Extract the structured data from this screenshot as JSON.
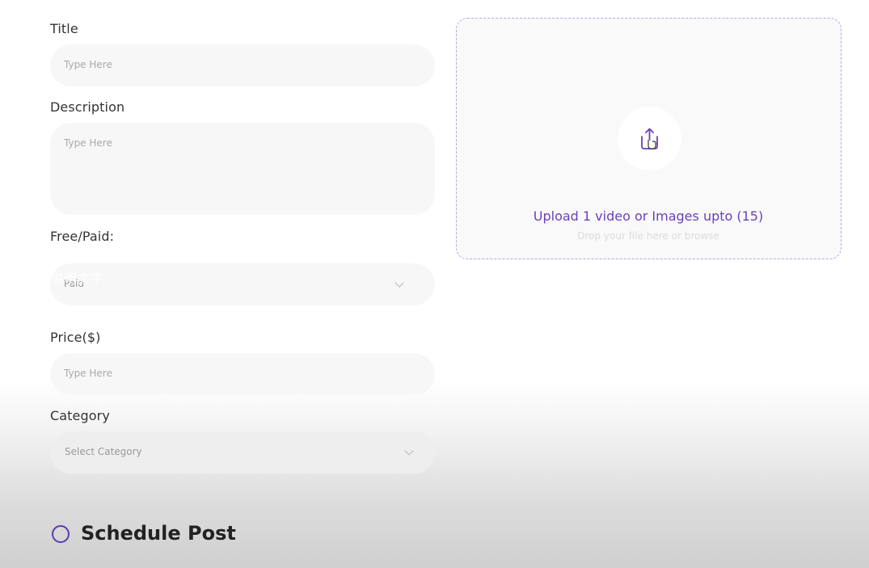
{
  "form": {
    "title_label": "Title",
    "title_placeholder": "Type Here",
    "description_label": "Description",
    "description_placeholder": "Type Here",
    "free_paid_label": "Free/Paid:",
    "free_paid_value": "Paid",
    "price_label": "Price($)",
    "price_placeholder": "Type Here",
    "category_label": "Category",
    "category_value": "Select Category"
  },
  "upload": {
    "icon": "upload-icon",
    "title": "Upload 1 video or Images upto (15)",
    "subtitle": "Drop your file here or browse"
  },
  "schedule": {
    "label": "Schedule Post",
    "checked": false
  },
  "overlay": {
    "text": "说明文字"
  },
  "colors": {
    "accent": "#6a3fb8",
    "radio_border": "#5b3bb0",
    "upload_border": "#b9a6e6",
    "field_bg": "#f7f7f7"
  }
}
